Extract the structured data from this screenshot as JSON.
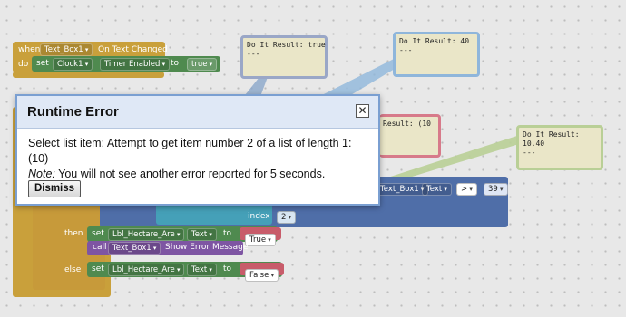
{
  "event_block": {
    "keyword_when": "when",
    "component": "Text_Box1",
    "event_name": "On Text Changed",
    "keyword_do": "do",
    "keyword_set": "set",
    "set_component": "Clock1",
    "set_property": "Timer Enabled",
    "keyword_to": "to",
    "value": "true"
  },
  "logic_block": {
    "textbox_ref": "Text_Box1",
    "text_prop": "Text",
    "compare_op": ">",
    "compare_value": "39",
    "index_label": "index",
    "index_value": "2",
    "then_label": "then",
    "then_set": "set",
    "then_component": "Lbl_Hectare_Are",
    "then_property": "Text",
    "then_to": "to",
    "then_value": "True",
    "call_label": "call",
    "call_component": "Text_Box1",
    "call_method": "Show Error Message",
    "else_label": "else",
    "else_set": "set",
    "else_component": "Lbl_Hectare_Are",
    "else_property": "Text",
    "else_to": "to",
    "else_value": "False"
  },
  "bubbles": [
    {
      "text": "Do It Result: true\n---"
    },
    {
      "text": "Do It Result: 40\n---"
    },
    {
      "text": "Result: (10"
    },
    {
      "text": "Do It Result:\n10.40\n---"
    }
  ],
  "dialog": {
    "title": "Runtime Error",
    "close_glyph": "✕",
    "message": "Select list item: Attempt to get item number 2 of a list of length 1: (10)",
    "note_label": "Note:",
    "note_text": " You will not see another error reported for 5 seconds.",
    "button_label": "Dismiss"
  },
  "colors": {
    "event": "#c9a03b",
    "set": "#4f8a4f",
    "logic_blue": "#4f6ea8",
    "list": "#45a0b8",
    "call": "#7e55a3",
    "bool": "#c85c6a",
    "dialog_border": "#7a9fd1"
  }
}
